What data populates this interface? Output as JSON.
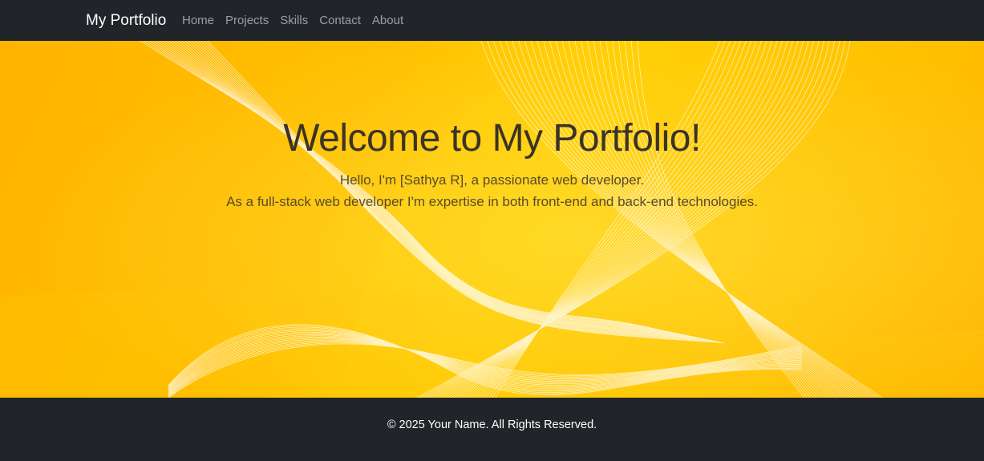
{
  "navbar": {
    "brand": "My Portfolio",
    "links": [
      {
        "label": "Home"
      },
      {
        "label": "Projects"
      },
      {
        "label": "Skills"
      },
      {
        "label": "Contact"
      },
      {
        "label": "About"
      }
    ]
  },
  "hero": {
    "title": "Welcome to My Portfolio!",
    "line1": "Hello, I'm [Sathya R], a passionate web developer.",
    "line2": "As a full-stack web developer I'm expertise in both front-end and back-end technologies."
  },
  "footer": {
    "text": "© 2025 Your Name. All Rights Reserved."
  },
  "colors": {
    "navbar_bg": "#212529",
    "hero_gradient_start": "#ffb300",
    "hero_gradient_mid": "#ffd000",
    "hero_gradient_end": "#ff9e00",
    "title_text": "#3b3326",
    "footer_bg": "#212529"
  }
}
